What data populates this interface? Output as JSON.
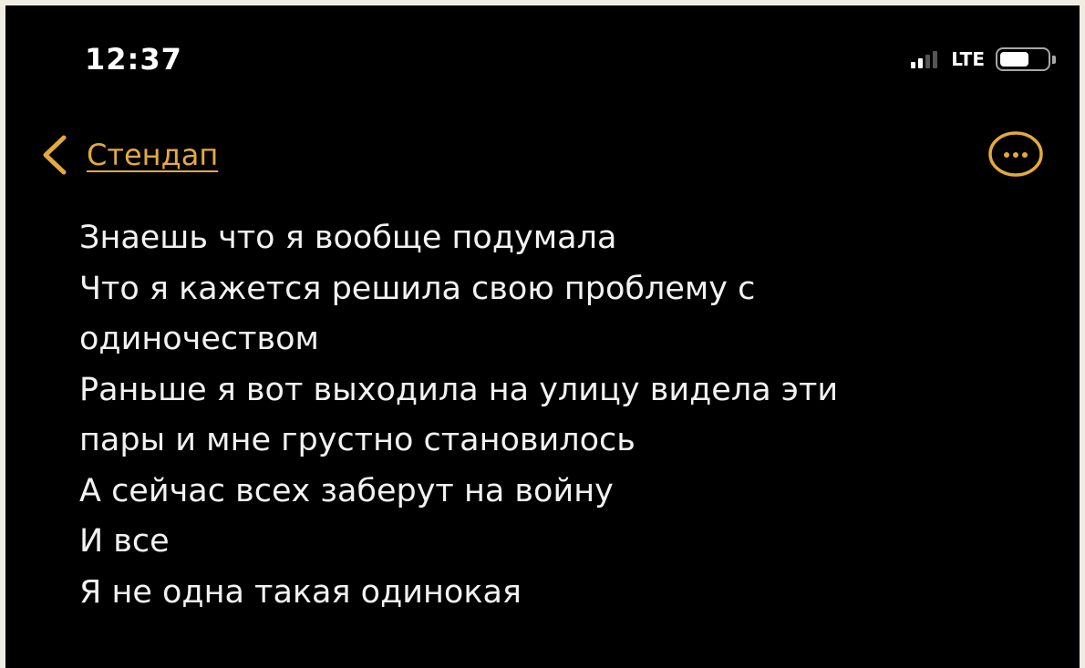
{
  "status_bar": {
    "time": "12:37",
    "network": "LTE",
    "signal_bars_on": 2,
    "signal_bars_total": 4,
    "battery_level": 0.7
  },
  "nav": {
    "back_label": "Стендап",
    "back_icon": "chevron-left-icon",
    "more_icon": "ellipsis-circle-icon"
  },
  "note": {
    "lines": [
      "Знаешь что я вообще подумала",
      "Что я кажется решила свою проблему с",
      "одиночеством",
      "Раньше я вот выходила на улицу видела эти",
      "пары и мне грустно становилось",
      "А сейчас всех заберут на войну",
      "И все",
      "Я не одна такая одинокая"
    ]
  },
  "colors": {
    "background": "#000000",
    "accent": "#e3aa3c",
    "text": "#f2f2f2"
  }
}
